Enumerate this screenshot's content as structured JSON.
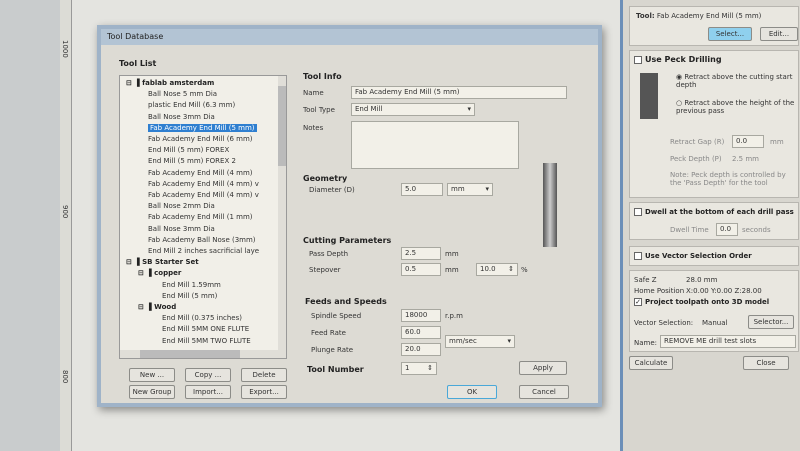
{
  "dialog": {
    "title": "Tool Database",
    "tool_list_label": "Tool List",
    "tree": [
      {
        "label": "fablab amsterdam",
        "level": 0,
        "group": true
      },
      {
        "label": "Ball Nose 5 mm Dia",
        "level": 1
      },
      {
        "label": "plastic End Mill (6.3 mm)",
        "level": 1
      },
      {
        "label": "Ball Nose 3mm Dia",
        "level": 1
      },
      {
        "label": "Fab Academy End Mill (5 mm)",
        "level": 1,
        "selected": true
      },
      {
        "label": "Fab Academy End Mill (6 mm)",
        "level": 1
      },
      {
        "label": "End Mill (5 mm) FOREX",
        "level": 1
      },
      {
        "label": "End Mill (5 mm) FOREX 2",
        "level": 1
      },
      {
        "label": "Fab Academy End Mill (4 mm)",
        "level": 1
      },
      {
        "label": "Fab Academy End Mill (4 mm) v",
        "level": 1
      },
      {
        "label": "Fab Academy End Mill (4 mm) v",
        "level": 1
      },
      {
        "label": "Ball Nose 2mm Dia",
        "level": 1
      },
      {
        "label": "Fab Academy End Mill (1 mm)",
        "level": 1
      },
      {
        "label": "Ball Nose 3mm Dia",
        "level": 1
      },
      {
        "label": "Fab Academy Ball Nose (3mm)",
        "level": 1
      },
      {
        "label": "End Mill 2 inches sacrificial laye",
        "level": 1
      },
      {
        "label": "SB Starter Set",
        "level": 0,
        "group": true
      },
      {
        "label": "copper",
        "level": 1,
        "group": true
      },
      {
        "label": "End Mill 1.59mm",
        "level": 2
      },
      {
        "label": "End Mill (5 mm)",
        "level": 2
      },
      {
        "label": "Wood",
        "level": 1,
        "group": true
      },
      {
        "label": "End Mill (0.375 inches)",
        "level": 2
      },
      {
        "label": "End Mill 5MM ONE FLUTE",
        "level": 2
      },
      {
        "label": "End Mill 5MM TWO FLUTE",
        "level": 2
      }
    ],
    "list_buttons": [
      "New ...",
      "Copy ...",
      "Delete",
      "New Group",
      "Import...",
      "Export..."
    ],
    "tool_info": {
      "heading": "Tool Info",
      "name_label": "Name",
      "name_value": "Fab Academy End Mill (5 mm)",
      "type_label": "Tool Type",
      "type_value": "End Mill",
      "notes_label": "Notes"
    },
    "geometry": {
      "heading": "Geometry",
      "diameter_label": "Diameter (D)",
      "diameter_value": "5.0",
      "unit": "mm"
    },
    "cutting": {
      "heading": "Cutting Parameters",
      "pass_depth_label": "Pass Depth",
      "pass_depth_value": "2.5",
      "pass_depth_unit": "mm",
      "stepover_label": "Stepover",
      "stepover_value": "0.5",
      "stepover_unit": "mm",
      "stepover_pct": "10.0",
      "pct": "%"
    },
    "feeds": {
      "heading": "Feeds and Speeds",
      "spindle_label": "Spindle Speed",
      "spindle_value": "18000",
      "spindle_unit": "r.p.m",
      "feed_label": "Feed Rate",
      "feed_value": "60.0",
      "plunge_label": "Plunge Rate",
      "plunge_value": "20.0",
      "rate_unit": "mm/sec"
    },
    "tool_number": {
      "label": "Tool Number",
      "value": "1"
    },
    "apply": "Apply",
    "ok": "OK",
    "cancel": "Cancel"
  },
  "panel": {
    "tool_label": "Tool:",
    "tool_value": "Fab Academy End Mill (5 mm)",
    "select": "Select...",
    "edit": "Edit...",
    "peck": {
      "label": "Use Peck Drilling",
      "opt1": "Retract above the cutting start depth",
      "opt2": "Retract above the height of the previous pass",
      "retract_label": "Retract Gap (R)",
      "retract_value": "0.0",
      "retract_unit": "mm",
      "peck_depth_label": "Peck Depth (P)",
      "peck_depth_value": "2.5 mm",
      "note": "Note: Peck depth is controlled by the 'Pass Depth' for the tool"
    },
    "dwell": {
      "label": "Dwell at the bottom of each drill pass",
      "time_label": "Dwell Time",
      "time_value": "0.0",
      "time_unit": "seconds"
    },
    "vector_order": "Use Vector Selection Order",
    "safe_z_label": "Safe Z",
    "safe_z_value": "28.0 mm",
    "home_label": "Home Position",
    "home_value": "X:0.00 Y:0.00 Z:28.00",
    "project": "Project toolpath onto 3D model",
    "vector_sel_label": "Vector Selection:",
    "vector_sel_value": "Manual",
    "selector": "Selector...",
    "name_label": "Name:",
    "name_value": "REMOVE ME drill test slots",
    "calculate": "Calculate",
    "close": "Close"
  },
  "ruler": {
    "marks": [
      "1000",
      "900",
      "800"
    ]
  }
}
